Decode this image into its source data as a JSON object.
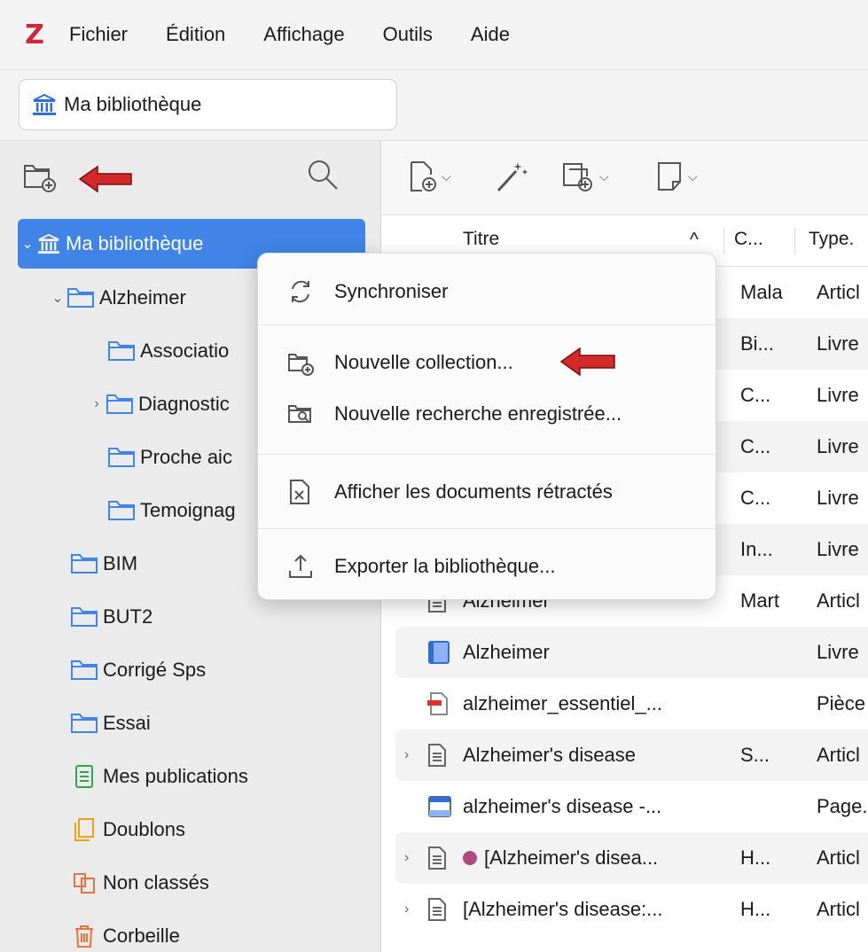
{
  "app": {
    "logo": "Z",
    "accent": "#cc2936",
    "selection_color": "#3f84e6"
  },
  "menubar": {
    "items": [
      "Fichier",
      "Édition",
      "Affichage",
      "Outils",
      "Aide"
    ]
  },
  "tab": {
    "label": "Ma bibliothèque",
    "icon": "library-icon"
  },
  "sidebar": {
    "toolbar": {
      "new_collection_icon": "new-collection-icon",
      "search_icon": "search-icon"
    },
    "tree": [
      {
        "label": "Ma bibliothèque",
        "icon": "library-icon",
        "twisty": "⌄",
        "selected": true
      },
      {
        "label": "Alzheimer",
        "icon": "folder-icon",
        "twisty": "⌄"
      },
      {
        "label": "Associatio",
        "icon": "folder-icon"
      },
      {
        "label": "Diagnostic",
        "icon": "folder-icon",
        "twisty": "›"
      },
      {
        "label": "Proche aic",
        "icon": "folder-icon"
      },
      {
        "label": "Temoignag",
        "icon": "folder-icon"
      },
      {
        "label": "BIM",
        "icon": "folder-icon"
      },
      {
        "label": "BUT2",
        "icon": "folder-icon"
      },
      {
        "label": "Corrigé Sps",
        "icon": "folder-icon"
      },
      {
        "label": "Essai",
        "icon": "folder-icon"
      },
      {
        "label": "Mes publications",
        "icon": "publications-icon"
      },
      {
        "label": "Doublons",
        "icon": "duplicates-icon"
      },
      {
        "label": "Non classés",
        "icon": "unfiled-icon"
      },
      {
        "label": "Corbeille",
        "icon": "trash-icon"
      }
    ]
  },
  "main": {
    "toolbar": [
      "new-item-icon",
      "magic-wand-icon",
      "add-attachment-icon",
      "new-note-icon"
    ],
    "columns": {
      "title": "Titre",
      "sort_indicator": "^",
      "creator": "C...",
      "type": "Type."
    },
    "items": [
      {
        "title": "",
        "creator": "Mala",
        "type": "Articl"
      },
      {
        "title": "",
        "creator": "Bi...",
        "type": "Livre"
      },
      {
        "title": "",
        "creator": "C...",
        "type": "Livre"
      },
      {
        "title": "",
        "creator": "C...",
        "type": "Livre"
      },
      {
        "title": "",
        "creator": "C...",
        "type": "Livre"
      },
      {
        "title": "",
        "creator": "In...",
        "type": "Livre"
      },
      {
        "title": "Alzheimer",
        "creator": "Mart",
        "type": "Articl",
        "icon": "article-icon"
      },
      {
        "title": "Alzheimer",
        "creator": "",
        "type": "Livre",
        "icon": "book-icon"
      },
      {
        "title": "alzheimer_essentiel_...",
        "creator": "",
        "type": "Pièce",
        "icon": "pdf-attachment-icon"
      },
      {
        "title": "Alzheimer's disease",
        "creator": "S...",
        "type": "Articl",
        "icon": "article-icon",
        "twisty": "›"
      },
      {
        "title": "alzheimer's disease -...",
        "creator": "",
        "type": "Page.",
        "icon": "webpage-icon"
      },
      {
        "title": "[Alzheimer's disea...",
        "creator": "H...",
        "type": "Articl",
        "icon": "article-icon",
        "twisty": "›",
        "tag_color": "#b04a7c"
      },
      {
        "title": "[Alzheimer's disease:...",
        "creator": "H...",
        "type": "Articl",
        "icon": "article-icon",
        "twisty": "›"
      }
    ]
  },
  "context_menu": {
    "items": [
      {
        "label": "Synchroniser",
        "icon": "sync-icon"
      },
      {
        "label": "Nouvelle collection...",
        "icon": "new-collection-icon"
      },
      {
        "label": "Nouvelle recherche enregistrée...",
        "icon": "saved-search-icon"
      },
      {
        "label": "Afficher les documents rétractés",
        "icon": "retracted-icon"
      },
      {
        "label": "Exporter la bibliothèque...",
        "icon": "export-icon"
      }
    ]
  },
  "annotations": {
    "arrow_color": "#d42a2a"
  }
}
